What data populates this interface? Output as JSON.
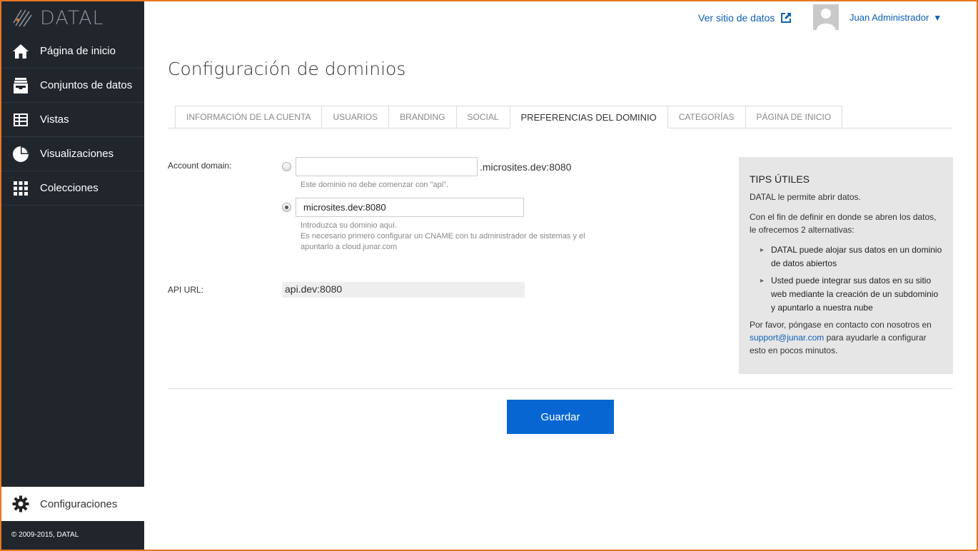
{
  "brand": {
    "name": "DATAL"
  },
  "sidebar": {
    "items": [
      {
        "label": "Página de inicio",
        "icon": "home-icon"
      },
      {
        "label": "Conjuntos de datos",
        "icon": "inbox-icon"
      },
      {
        "label": "Vistas",
        "icon": "table-icon"
      },
      {
        "label": "Visualizaciones",
        "icon": "pie-chart-icon"
      },
      {
        "label": "Colecciones",
        "icon": "grid-icon"
      }
    ],
    "settings_label": "Configuraciones",
    "copyright": "© 2009-2015, DATAL"
  },
  "header": {
    "view_site_label": "Ver sitio de datos",
    "user_name": "Juan Administrador",
    "caret": "▼"
  },
  "main": {
    "title": "Configuración de dominios",
    "tabs": [
      {
        "label": "INFORMACIÓN DE LA CUENTA",
        "active": false
      },
      {
        "label": "USUARIOS",
        "active": false
      },
      {
        "label": "BRANDING",
        "active": false
      },
      {
        "label": "SOCIAL",
        "active": false
      },
      {
        "label": "PREFERENCIAS DEL DOMINIO",
        "active": true
      },
      {
        "label": "CATEGORÍAS",
        "active": false
      },
      {
        "label": "PÁGINA DE INICIO",
        "active": false
      }
    ]
  },
  "form": {
    "account_domain_label": "Account domain:",
    "subdomain_value": "",
    "subdomain_suffix": ".microsites.dev:8080",
    "subdomain_hint": "Este dominio no debe comenzar con \"api\".",
    "custom_domain_value": "microsites.dev:8080",
    "custom_hint_1": "Introduzca su dominio aquí.",
    "custom_hint_2": "Es necesario primero configurar un CNAME con tu administrador de sistemas y el",
    "custom_hint_3": "apuntarlo a cloud.junar.com",
    "api_url_label": "API URL:",
    "api_url_value": "api.dev:8080",
    "save_label": "Guardar"
  },
  "tips": {
    "title": "TIPS ÚTILES",
    "p1": "DATAL le permite abrir datos.",
    "p2": "Con el fin de definir en donde se abren los datos, le ofrecemos 2 alternativas:",
    "bullet1": "DATAL puede alojar sus datos en un dominio de datos abiertos",
    "bullet2": "Usted puede integrar sus datos en su sitio web mediante la creación de un subdominio y apuntarlo a nuestra nube",
    "p3_before": "Por favor, póngase en contacto con nosotros en",
    "email": "support@junar.com",
    "p3_after": "para ayudarle a configurar esto en pocos minutos."
  },
  "colors": {
    "accent": "#0866d2",
    "sidebar": "#21262d",
    "frame": "#e87722",
    "link": "#0d5fb8"
  }
}
